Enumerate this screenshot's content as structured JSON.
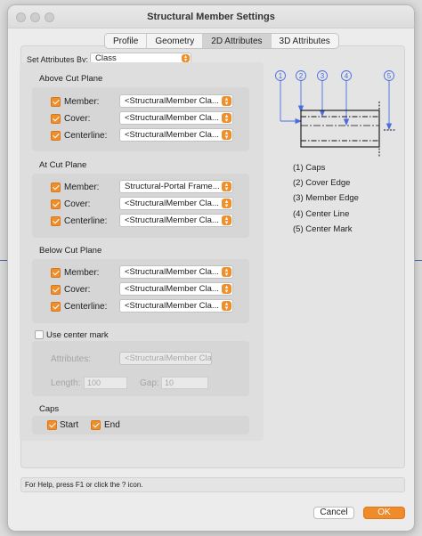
{
  "window": {
    "title": "Structural Member Settings"
  },
  "tabs": [
    {
      "label": "Profile",
      "active": false
    },
    {
      "label": "Geometry",
      "active": false
    },
    {
      "label": "2D Attributes",
      "active": true
    },
    {
      "label": "3D Attributes",
      "active": false
    }
  ],
  "set_attributes": {
    "label": "Set Attributes By:",
    "value": "Class"
  },
  "above": {
    "title": "Above Cut Plane",
    "rows": [
      {
        "label": "Member:",
        "value": "<StructuralMember Cla...",
        "checked": true
      },
      {
        "label": "Cover:",
        "value": "<StructuralMember Cla...",
        "checked": true
      },
      {
        "label": "Centerline:",
        "value": "<StructuralMember Cla...",
        "checked": true
      }
    ]
  },
  "at": {
    "title": "At Cut Plane",
    "rows": [
      {
        "label": "Member:",
        "value": "Structural-Portal Frame...",
        "checked": true
      },
      {
        "label": "Cover:",
        "value": "<StructuralMember Cla...",
        "checked": true
      },
      {
        "label": "Centerline:",
        "value": "<StructuralMember Cla...",
        "checked": true
      }
    ]
  },
  "below": {
    "title": "Below Cut Plane",
    "rows": [
      {
        "label": "Member:",
        "value": "<StructuralMember Cla...",
        "checked": true
      },
      {
        "label": "Cover:",
        "value": "<StructuralMember Cla...",
        "checked": true
      },
      {
        "label": "Centerline:",
        "value": "<StructuralMember Cla...",
        "checked": true
      }
    ]
  },
  "center_mark": {
    "label": "Use center mark",
    "checked": false,
    "attributes_label": "Attributes:",
    "attributes_value": "<StructuralMember Cla...",
    "length_label": "Length:",
    "length_value": "100",
    "gap_label": "Gap:",
    "gap_value": "10"
  },
  "caps": {
    "title": "Caps",
    "start_label": "Start",
    "start_checked": true,
    "end_label": "End",
    "end_checked": true
  },
  "diagram": {
    "markers": [
      "1",
      "2",
      "3",
      "4",
      "5"
    ]
  },
  "legend": [
    "(1) Caps",
    "(2) Cover Edge",
    "(3) Member Edge",
    "(4) Center Line",
    "(5) Center Mark"
  ],
  "help_text": "For Help, press F1 or click the ? icon.",
  "buttons": {
    "cancel": "Cancel",
    "ok": "OK"
  },
  "colors": {
    "accent": "#ef8b2a",
    "diagram_blue": "#4a6ee0"
  }
}
